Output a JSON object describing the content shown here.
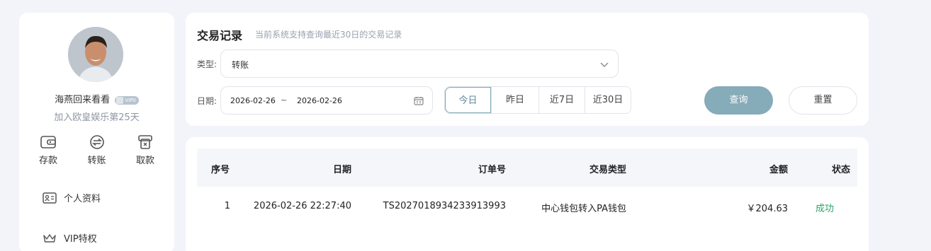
{
  "profile": {
    "username": "海燕回来看看",
    "vip_label": "VIP0",
    "join_text": "加入欧皇娱乐第25天"
  },
  "quick_actions": [
    {
      "label": "存款",
      "icon": "wallet-icon"
    },
    {
      "label": "转账",
      "icon": "transfer-icon"
    },
    {
      "label": "取款",
      "icon": "withdraw-icon"
    }
  ],
  "menu": [
    {
      "label": "个人资料",
      "icon": "id-card-icon"
    },
    {
      "label": "VIP特权",
      "icon": "crown-icon"
    }
  ],
  "filter": {
    "title": "交易记录",
    "subtitle": "当前系统支持查询最近30日的交易记录",
    "type_label": "类型:",
    "type_value": "转账",
    "date_label": "日期:",
    "date_start": "2026-02-26",
    "date_sep": "~",
    "date_end": "2026-02-26",
    "quick_ranges": [
      "今日",
      "昨日",
      "近7日",
      "近30日"
    ],
    "active_range": "今日",
    "query_label": "查询",
    "reset_label": "重置"
  },
  "table": {
    "headers": [
      "序号",
      "日期",
      "订单号",
      "交易类型",
      "金额",
      "状态"
    ],
    "rows": [
      [
        "1",
        "2026-02-26 22:27:40",
        "TS2027018934233913993",
        "中心钱包转入PA钱包",
        "￥204.63",
        "成功"
      ]
    ]
  },
  "colors": {
    "accent": "#86abb9",
    "success": "#2aa569",
    "background": "#f3f4f9"
  }
}
